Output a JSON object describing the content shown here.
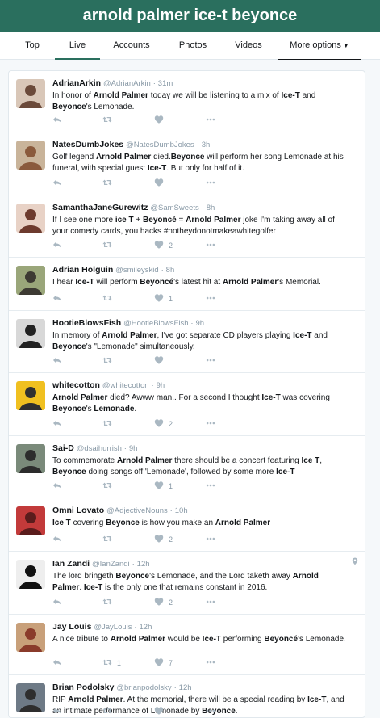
{
  "header": {
    "title": "arnold palmer ice-t beyonce"
  },
  "tabs": [
    {
      "label": "Top"
    },
    {
      "label": "Live"
    },
    {
      "label": "Accounts"
    },
    {
      "label": "Photos"
    },
    {
      "label": "Videos"
    },
    {
      "label": "More options"
    }
  ],
  "tweets": [
    {
      "name": "AdrianArkin",
      "handle": "@AdrianArkin",
      "time": "31m",
      "html": "In honor of <b>Arnold Palmer</b> today we will be listening to a mix of <b>Ice-T</b> and <b>Beyonce</b>'s Lemonade.",
      "likes": "",
      "retweets": ""
    },
    {
      "name": "NatesDumbJokes",
      "handle": "@NatesDumbJokes",
      "time": "3h",
      "html": "Golf legend <b>Arnold Palmer</b> died.<b>Beyonce</b> will perform her song Lemonade at his funeral, with special guest <b>Ice-T</b>. But only for half of it.",
      "likes": "",
      "retweets": ""
    },
    {
      "name": "SamanthaJaneGurewitz",
      "handle": "@SamSweets",
      "time": "8h",
      "html": "If I see one more <b>ice T</b> + <b>Beyoncé</b> = <b>Arnold Palmer</b> joke I'm taking away all of your comedy cards, you hacks #notheydonotmakeawhitegolfer",
      "likes": "2",
      "retweets": ""
    },
    {
      "name": "Adrian Holguin",
      "handle": "@smileyskid",
      "time": "8h",
      "html": "I hear <b>Ice-T</b> will perform <b>Beyoncé</b>'s latest hit at <b>Arnold Palmer</b>'s Memorial.",
      "likes": "1",
      "retweets": ""
    },
    {
      "name": "HootieBlowsFish",
      "handle": "@HootieBlowsFish",
      "time": "9h",
      "html": "In memory of <b>Arnold Palmer</b>, I've got separate CD players playing <b>Ice-T</b> and <b>Beyonce</b>'s \"Lemonade\" simultaneously.",
      "likes": "",
      "retweets": ""
    },
    {
      "name": "whitecotton",
      "handle": "@whitecotton",
      "time": "9h",
      "html": "<b>Arnold Palmer</b> died? Awww man.. For a second I thought <b>Ice-T</b> was covering <b>Beyonce</b>'s <b>Lemonade</b>.",
      "likes": "2",
      "retweets": ""
    },
    {
      "name": "Sai-D",
      "handle": "@dsaihurrish",
      "time": "9h",
      "html": "To commemorate <b>Arnold Palmer</b> there should be a concert featuring <b>Ice T</b>, <b>Beyonce</b> doing songs off 'Lemonade', followed by some more <b>Ice-T</b>",
      "likes": "1",
      "retweets": ""
    },
    {
      "name": "Omni Lovato",
      "handle": "@AdjectiveNouns",
      "time": "10h",
      "html": "<b>Ice T</b> covering <b>Beyonce</b> is how you make an <b>Arnold Palmer</b>",
      "likes": "2",
      "retweets": ""
    },
    {
      "name": "Ian Zandi",
      "handle": "@IanZandi",
      "time": "12h",
      "html": "The lord bringeth <b>Beyonce</b>'s Lemonade, and the Lord taketh away <b>Arnold Palmer</b>. <b>Ice-T</b> is the only one that remains constant in 2016.",
      "likes": "2",
      "retweets": "",
      "pin": true
    },
    {
      "name": "Jay Louis",
      "handle": "@JayLouis",
      "time": "12h",
      "html": "A nice tribute to <b>Arnold Palmer</b> would be <b>Ice-T</b> performing <b>Beyoncé</b>'s Lemonade.",
      "likes": "7",
      "retweets": "1"
    },
    {
      "name": "Brian Podolsky",
      "handle": "@brianpodolsky",
      "time": "12h",
      "html": "RIP <b>Arnold Palmer</b>. At the memorial, there will be a special reading by <b>Ice-T</b>, and an intimate performance of Lemonade by <b>Beyonce</b>.",
      "likes": "",
      "retweets": ""
    }
  ]
}
